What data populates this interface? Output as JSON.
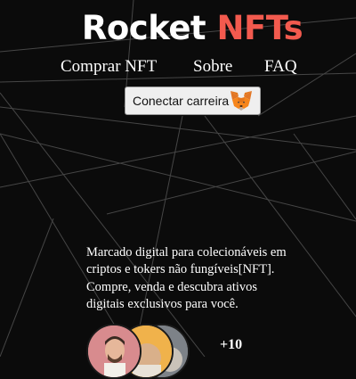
{
  "logo": {
    "word1": "Rocket",
    "word2": "NFTs"
  },
  "nav": {
    "items": [
      {
        "label": "Comprar NFT"
      },
      {
        "label": "Sobre"
      },
      {
        "label": "FAQ"
      }
    ]
  },
  "wallet_button": {
    "label": "Conectar carreira",
    "icon": "metamask-fox-icon"
  },
  "hero": {
    "description": "Marcado digital para colecionáveis em criptos e tokers não fungíveis[NFT]. Compre, venda e descubra ativos digitais exclusivos para você."
  },
  "community": {
    "more_count": "+10"
  },
  "colors": {
    "background": "#0b0b0b",
    "accent": "#f25a4e",
    "text": "#ffffff"
  }
}
